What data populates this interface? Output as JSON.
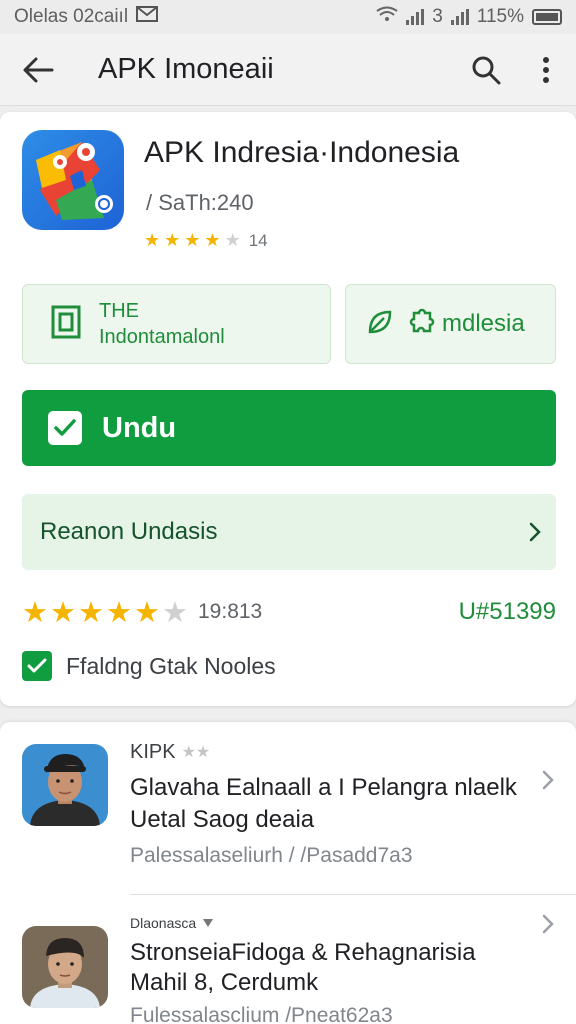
{
  "status_bar": {
    "left_text": "Olelas 02caiıl",
    "right_text": "3",
    "battery": "115%"
  },
  "app_bar": {
    "title": "APK Imoneaii",
    "back_icon": "arrow-left-icon",
    "search_icon": "search-icon",
    "more_icon": "more-vert-icon"
  },
  "app": {
    "name": "APK Indresia·Indonesia",
    "size": "/ SaTh:240",
    "rating_count": "14",
    "stars_filled": 4,
    "stars_total": 5
  },
  "info_buttons": {
    "left": {
      "line1": "ТНЕ",
      "line2": "Indontamalonl"
    },
    "right": {
      "label": "mdlesia"
    }
  },
  "download": {
    "label": "Undu"
  },
  "review": {
    "label": "Reanon Undasis"
  },
  "rating_row": {
    "stars_filled": 5,
    "stars_total": 6,
    "count": "19:813",
    "code": "U#51399"
  },
  "checkbox": {
    "label": "Ffaldng Gtak Nooles",
    "checked": true
  },
  "list": {
    "items": [
      {
        "head": "KIPK",
        "title": "Glavaha Ealnaall a I Pelangra nlaelk Uetal Saog deaia",
        "sub": "Palessalaseliurh / /Pasadd7a3"
      },
      {
        "head": "Dlaonasca",
        "title": "StronseiaFidoga & Rehagnarisia Mahil 8, Cerdumk",
        "sub": "Fulessalasclium /Pneat62a3"
      }
    ]
  },
  "colors": {
    "accent_green": "#109d3f",
    "accent_text_green": "#1f8d3a",
    "star_gold": "#f4b400",
    "star_empty": "#d0d0d0"
  }
}
